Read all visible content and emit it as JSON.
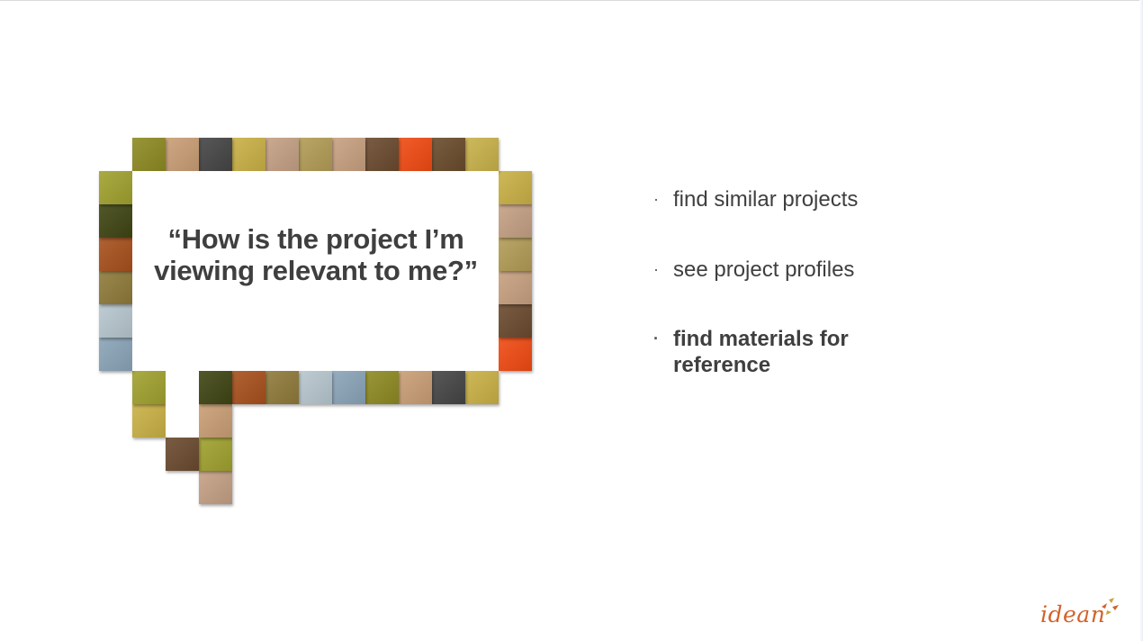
{
  "quote": {
    "text": "“How is the project I’m viewing relevant to me?”"
  },
  "bullets": [
    {
      "text": "find similar projects",
      "emphasized": false
    },
    {
      "text": "see project profiles",
      "emphasized": false
    },
    {
      "text": "find materials for reference",
      "emphasized": true
    }
  ],
  "bullet_marker": "·",
  "logo": {
    "text": "idean"
  },
  "colors": {
    "text": "#3f3f3f",
    "logo": "#d2622a",
    "tile_palette": [
      "#8d8a22",
      "#c99e75",
      "#454545",
      "#c9b045",
      "#c4a084",
      "#b29c55",
      "#c8a080",
      "#6a4a2e",
      "#f04a12",
      "#6a4b2c",
      "#c9b14a",
      "#a0a12e",
      "#3f4513",
      "#a8501c",
      "#8f7a3a",
      "#b7c6cf",
      "#8aa4b8"
    ]
  },
  "icons": {
    "logo_mark": "idean-star-icon"
  }
}
